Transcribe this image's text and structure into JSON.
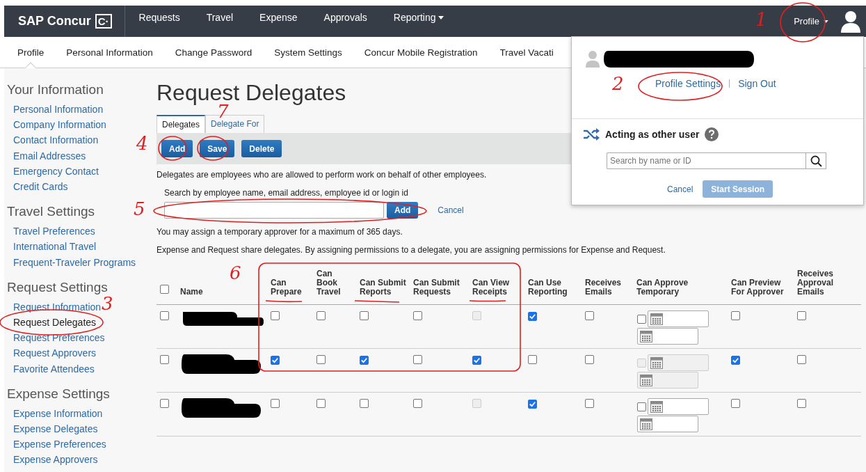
{
  "topbar": {
    "logo": "SAP Concur",
    "logo_mark": "C·",
    "nav": [
      {
        "label": "Requests",
        "dropdown": false
      },
      {
        "label": "Travel",
        "dropdown": false
      },
      {
        "label": "Expense",
        "dropdown": false
      },
      {
        "label": "Approvals",
        "dropdown": false
      },
      {
        "label": "Reporting",
        "dropdown": true
      }
    ],
    "profile": "Profile"
  },
  "subnav": [
    {
      "label": "Profile",
      "selected": true
    },
    {
      "label": "Personal Information",
      "selected": false
    },
    {
      "label": "Change Password",
      "selected": false
    },
    {
      "label": "System Settings",
      "selected": false
    },
    {
      "label": "Concur Mobile Registration",
      "selected": false
    },
    {
      "label": "Travel Vacati",
      "selected": false
    }
  ],
  "sidebar": [
    {
      "heading": "Your Information",
      "items": [
        {
          "label": "Personal Information",
          "selected": false
        },
        {
          "label": "Company Information",
          "selected": false
        },
        {
          "label": "Contact Information",
          "selected": false
        },
        {
          "label": "Email Addresses",
          "selected": false
        },
        {
          "label": "Emergency Contact",
          "selected": false
        },
        {
          "label": "Credit Cards",
          "selected": false
        }
      ]
    },
    {
      "heading": "Travel Settings",
      "items": [
        {
          "label": "Travel Preferences",
          "selected": false
        },
        {
          "label": "International Travel",
          "selected": false
        },
        {
          "label": "Frequent-Traveler Programs",
          "selected": false
        }
      ]
    },
    {
      "heading": "Request Settings",
      "items": [
        {
          "label": "Request Information",
          "selected": false
        },
        {
          "label": "Request Delegates",
          "selected": true
        },
        {
          "label": "Request Preferences",
          "selected": false
        },
        {
          "label": "Request Approvers",
          "selected": false
        },
        {
          "label": "Favorite Attendees",
          "selected": false
        }
      ]
    },
    {
      "heading": "Expense Settings",
      "items": [
        {
          "label": "Expense Information",
          "selected": false
        },
        {
          "label": "Expense Delegates",
          "selected": false
        },
        {
          "label": "Expense Preferences",
          "selected": false
        },
        {
          "label": "Expense Approvers",
          "selected": false
        }
      ]
    }
  ],
  "page": {
    "title": "Request Delegates",
    "tabs": [
      {
        "label": "Delegates",
        "selected": true
      },
      {
        "label": "Delegate For",
        "selected": false
      }
    ],
    "toolbar": [
      "Add",
      "Save",
      "Delete"
    ],
    "intro": "Delegates are employees who are allowed to perform work on behalf of other employees.",
    "search": {
      "label": "Search by employee name, email address, employee id or login id",
      "add": "Add",
      "cancel": "Cancel"
    },
    "notes": [
      "You may assign a temporary approver for a maximum of 365 days.",
      "Expense and Request share delegates. By assigning permissions to a delegate, you are assigning permissions for Expense and Request."
    ]
  },
  "table": {
    "select_all": {
      "checked": false
    },
    "name_header": "Name",
    "columns": [
      {
        "label": "Can Prepare",
        "kind": "check"
      },
      {
        "label": "Can Book Travel",
        "kind": "check"
      },
      {
        "label": "Can Submit Reports",
        "kind": "check"
      },
      {
        "label": "Can Submit Requests",
        "kind": "check"
      },
      {
        "label": "Can View Receipts",
        "kind": "check"
      },
      {
        "label": "Can Use Reporting",
        "kind": "check"
      },
      {
        "label": "Receives Emails",
        "kind": "check"
      },
      {
        "label": "Can Approve Temporary",
        "kind": "temporary"
      },
      {
        "label": "Can Preview For Approver",
        "kind": "check"
      },
      {
        "label": "Receives Approval Emails",
        "kind": "check"
      }
    ],
    "rows": [
      {
        "selected": false,
        "cells": [
          {
            "checked": false,
            "disabled": false
          },
          {
            "checked": false,
            "disabled": false
          },
          {
            "checked": false,
            "disabled": false
          },
          {
            "checked": false,
            "disabled": false
          },
          {
            "checked": false,
            "disabled": true
          },
          {
            "checked": true,
            "disabled": false
          },
          {
            "checked": false,
            "disabled": false
          },
          {
            "checked": false,
            "disabled": false
          },
          {
            "checked": false,
            "disabled": false
          },
          {
            "checked": false,
            "disabled": false
          }
        ]
      },
      {
        "selected": false,
        "cells": [
          {
            "checked": true,
            "disabled": false
          },
          {
            "checked": false,
            "disabled": false
          },
          {
            "checked": true,
            "disabled": false
          },
          {
            "checked": false,
            "disabled": false
          },
          {
            "checked": true,
            "disabled": false
          },
          {
            "checked": false,
            "disabled": false
          },
          {
            "checked": false,
            "disabled": false
          },
          {
            "checked": false,
            "disabled": true
          },
          {
            "checked": true,
            "disabled": false
          },
          {
            "checked": false,
            "disabled": false
          }
        ]
      },
      {
        "selected": false,
        "cells": [
          {
            "checked": false,
            "disabled": false
          },
          {
            "checked": false,
            "disabled": false
          },
          {
            "checked": false,
            "disabled": false
          },
          {
            "checked": false,
            "disabled": false
          },
          {
            "checked": false,
            "disabled": true
          },
          {
            "checked": true,
            "disabled": false
          },
          {
            "checked": false,
            "disabled": false
          },
          {
            "checked": false,
            "disabled": false
          },
          {
            "checked": false,
            "disabled": false
          },
          {
            "checked": false,
            "disabled": false
          }
        ]
      }
    ]
  },
  "profile_menu": {
    "links": [
      "Profile Settings",
      "Sign Out"
    ],
    "acting_title": "Acting as other user",
    "search_placeholder": "Search by name or ID",
    "cancel": "Cancel",
    "start": "Start Session",
    "start_disabled": true
  },
  "annotations": [
    "1",
    "2",
    "3",
    "4",
    "5",
    "6",
    "7"
  ]
}
